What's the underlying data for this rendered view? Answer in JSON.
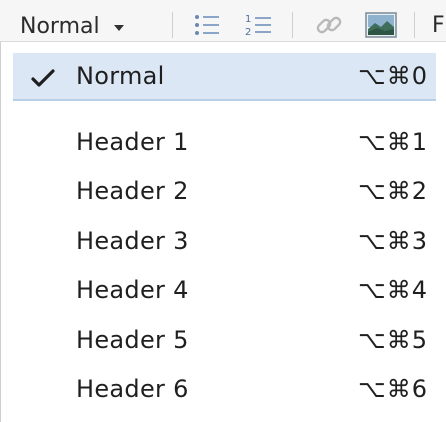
{
  "toolbar": {
    "style_select_value": "Normal",
    "icons": {
      "chevron": "chevron-down-icon",
      "bullet_list": "bullet-list-icon",
      "numbered_list": "numbered-list-icon",
      "link": "link-icon",
      "image": "image-icon"
    },
    "trailing_text": "F"
  },
  "menu": {
    "items": [
      {
        "label": "Normal",
        "shortcut": "⌥⌘0",
        "selected": true
      },
      {
        "label": "Header 1",
        "shortcut": "⌥⌘1",
        "selected": false
      },
      {
        "label": "Header 2",
        "shortcut": "⌥⌘2",
        "selected": false
      },
      {
        "label": "Header 3",
        "shortcut": "⌥⌘3",
        "selected": false
      },
      {
        "label": "Header 4",
        "shortcut": "⌥⌘4",
        "selected": false
      },
      {
        "label": "Header 5",
        "shortcut": "⌥⌘5",
        "selected": false
      },
      {
        "label": "Header 6",
        "shortcut": "⌥⌘6",
        "selected": false
      }
    ]
  },
  "colors": {
    "selected_bg": "#dbe7f4",
    "accent": "#7aa7d6"
  }
}
